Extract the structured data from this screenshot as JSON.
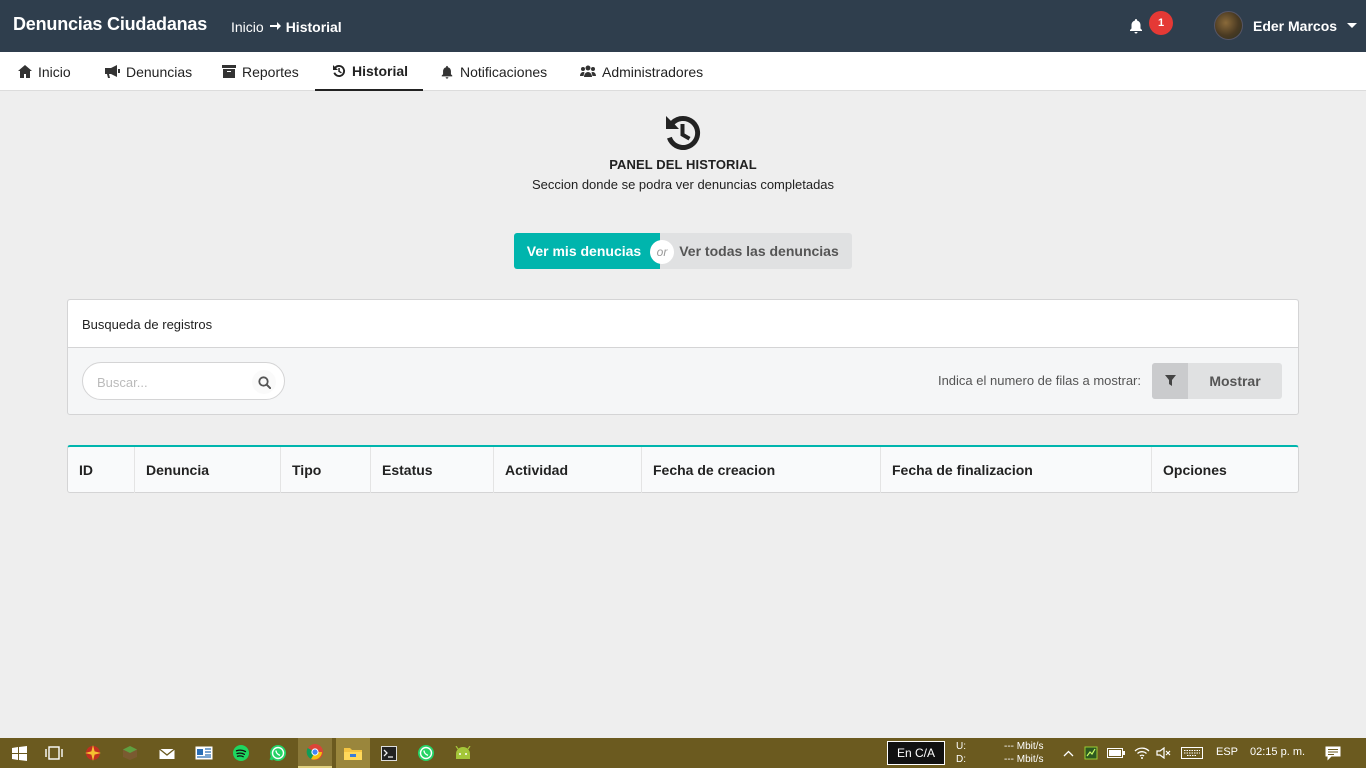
{
  "app": {
    "title": "Denuncias Ciudadanas"
  },
  "breadcrumb": {
    "home": "Inicio",
    "current": "Historial"
  },
  "notifications": {
    "count": "1"
  },
  "user": {
    "name": "Eder Marcos"
  },
  "nav": {
    "items": [
      {
        "label": "Inicio",
        "icon": "home-icon"
      },
      {
        "label": "Denuncias",
        "icon": "bullhorn-icon"
      },
      {
        "label": "Reportes",
        "icon": "archive-icon"
      },
      {
        "label": "Historial",
        "icon": "history-icon",
        "active": true
      },
      {
        "label": "Notificaciones",
        "icon": "bell-icon"
      },
      {
        "label": "Administradores",
        "icon": "users-icon"
      }
    ]
  },
  "panel": {
    "title": "PANEL DEL HISTORIAL",
    "subtitle": "Seccion donde se podra ver denuncias completadas"
  },
  "toggle": {
    "mine": "Ver mis denucias",
    "or": "or",
    "all": "Ver todas las denuncias"
  },
  "search_card": {
    "title": "Busqueda de registros",
    "search_placeholder": "Buscar...",
    "rows_label": "Indica el numero de filas a mostrar:",
    "show_button": "Mostrar"
  },
  "table": {
    "columns": [
      "ID",
      "Denuncia",
      "Tipo",
      "Estatus",
      "Actividad",
      "Fecha de creacion",
      "Fecha de finalizacion",
      "Opciones"
    ]
  },
  "taskbar": {
    "lang_box": "En C/A",
    "net_up_label": "U:",
    "net_down_label": "D:",
    "net_up_value": "--- Mbit/s",
    "net_down_value": "--- Mbit/s",
    "language": "ESP",
    "clock": "02:15 p. m."
  },
  "colors": {
    "accent": "#00b5ad",
    "topbar": "#2f3e4d",
    "badge": "#e53935",
    "taskbar": "#6b5a1f"
  }
}
